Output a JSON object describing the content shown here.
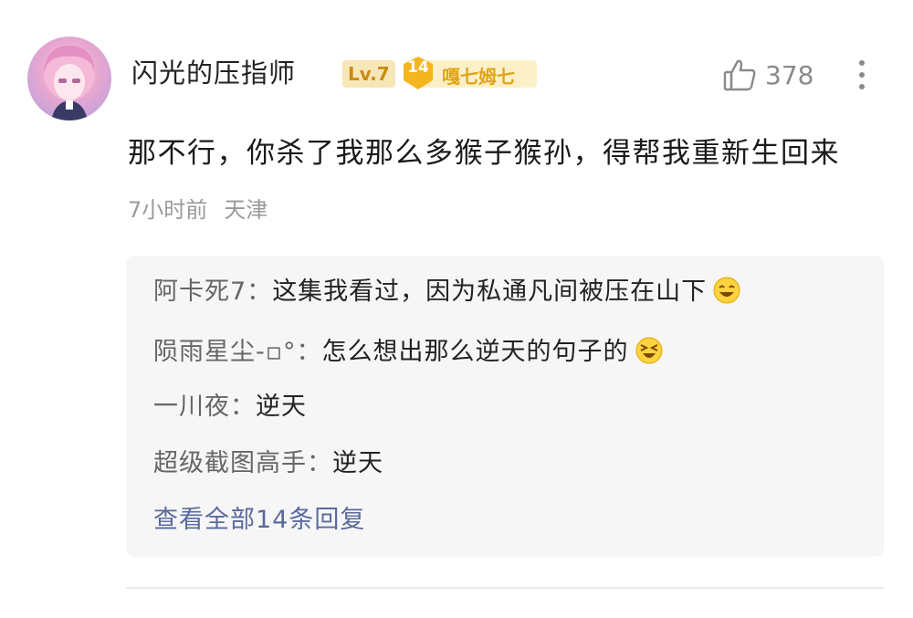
{
  "comment": {
    "username": "闪光的压指师",
    "level_badge": "Lv.7",
    "fan_badge": {
      "level": "14",
      "name": "嘎七姆七"
    },
    "like_count": "378",
    "text": "那不行，你杀了我那么多猴子猴孙，得帮我重新生回来",
    "time": "7小时前",
    "location": "天津"
  },
  "replies": [
    {
      "author": "阿卡死7：",
      "text": "这集我看过，因为私通凡间被压在山下",
      "emoji": "laugh-emoji"
    },
    {
      "author": "陨雨星尘-▫°：",
      "text": "怎么想出那么逆天的句子的",
      "emoji": "squint-laugh-emoji"
    },
    {
      "author": "一川夜：",
      "text": "逆天",
      "emoji": ""
    },
    {
      "author": "超级截图高手：",
      "text": "逆天",
      "emoji": ""
    }
  ],
  "view_all_label": "查看全部14条回复",
  "icons": {
    "like": "thumbs-up-icon",
    "more": "more-vertical-icon"
  },
  "colors": {
    "level_badge": "#c98b14",
    "fan_badge": "#e0a416",
    "link": "#5a6a9e",
    "reply_box": "#f6f6f6"
  }
}
